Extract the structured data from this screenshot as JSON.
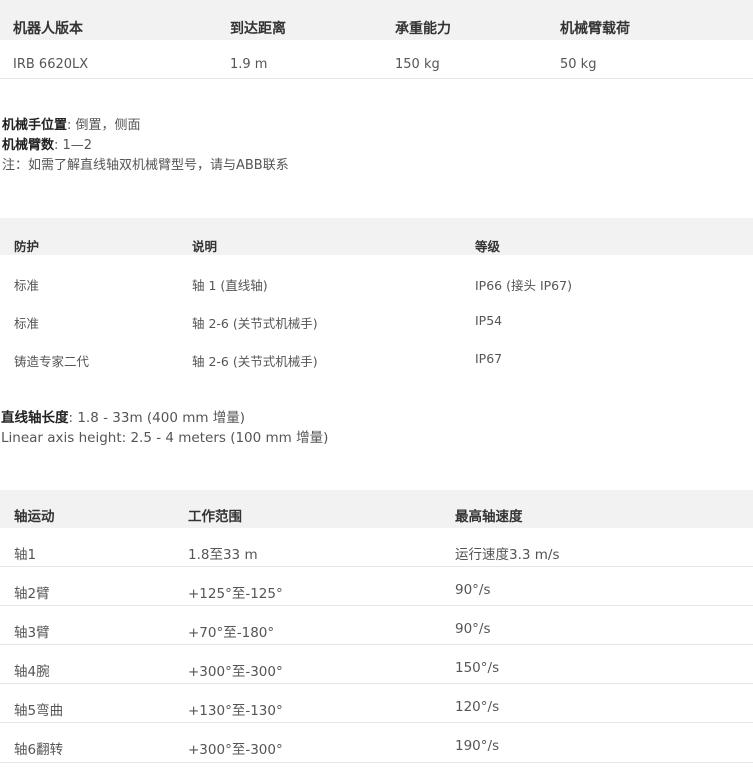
{
  "table1": {
    "headers": [
      "机器人版本",
      "到达距离",
      "承重能力",
      "机械臂载荷"
    ],
    "row": [
      "IRB 6620LX",
      "1.9 m",
      "150 kg",
      "50 kg"
    ]
  },
  "info": {
    "position_label": "机械手位置",
    "position_value": ": 倒置，侧面",
    "arms_label": "机械臂数",
    "arms_value": ": 1—2",
    "note": "注：如需了解直线轴双机械臂型号，请与ABB联系"
  },
  "table2": {
    "headers": [
      "防护",
      "说明",
      "等级"
    ],
    "rows": [
      [
        "标准",
        "轴 1 (直线轴)",
        "IP66 (接头 IP67)"
      ],
      [
        "标准",
        "轴 2-6 (关节式机械手)",
        "IP54"
      ],
      [
        "铸造专家二代",
        "轴 2-6 (关节式机械手)",
        "IP67"
      ]
    ]
  },
  "axis_info": {
    "length_label": "直线轴长度",
    "length_value": ": 1.8 - 33m (400 mm 增量)",
    "height_text": "Linear axis height: 2.5 - 4 meters (100 mm 增量)"
  },
  "table3": {
    "headers": [
      "轴运动",
      "工作范围",
      "最高轴速度"
    ],
    "rows": [
      [
        "轴1",
        "1.8至33 m",
        "运行速度3.3 m/s"
      ],
      [
        "轴2臂",
        "+125°至-125°",
        "90°/s"
      ],
      [
        "轴3臂",
        "+70°至-180°",
        "90°/s"
      ],
      [
        "轴4腕",
        "+300°至-300°",
        "150°/s"
      ],
      [
        "轴5弯曲",
        "+130°至-130°",
        "120°/s"
      ],
      [
        "轴6翻转",
        "+300°至-300°",
        "190°/s"
      ]
    ]
  }
}
